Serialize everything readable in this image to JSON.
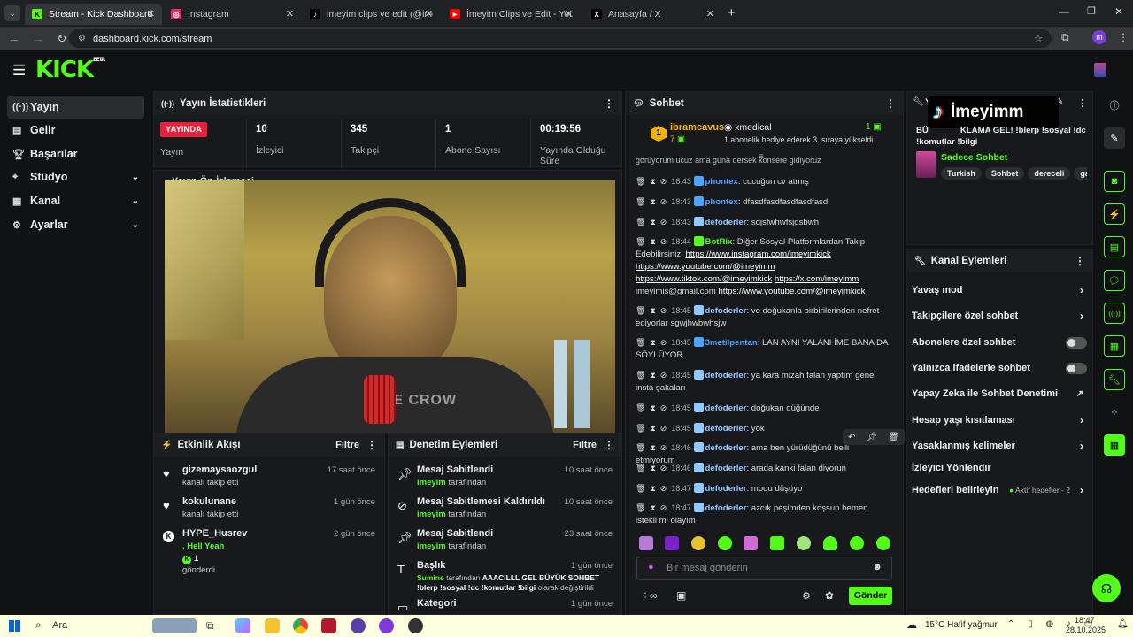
{
  "browser": {
    "tabs": [
      {
        "label": "Stream - Kick Dashboard",
        "color": "#53fc18",
        "glyph": "K"
      },
      {
        "label": "Instagram",
        "color": "#e1306c",
        "glyph": "◎"
      },
      {
        "label": "imeyim clips ve edit (@imeyimk",
        "color": "#111",
        "glyph": "♪"
      },
      {
        "label": "İmeyim Clips ve Edit - YouTube",
        "color": "#ff0000",
        "glyph": "▶"
      },
      {
        "label": "Anasayfa / X",
        "color": "#111",
        "glyph": "X"
      }
    ],
    "url": "dashboard.kick.com/stream",
    "profile_initial": "m"
  },
  "sidebar": {
    "items": [
      {
        "label": "Yayın",
        "icon": "broadcast-icon"
      },
      {
        "label": "Gelir",
        "icon": "revenue-icon"
      },
      {
        "label": "Başarılar",
        "icon": "trophy-icon"
      },
      {
        "label": "Stüdyo",
        "icon": "studio-icon"
      },
      {
        "label": "Kanal",
        "icon": "channel-icon"
      },
      {
        "label": "Ayarlar",
        "icon": "gear-icon"
      }
    ]
  },
  "stats": {
    "title": "Yayın İstatistikleri",
    "live_badge": "YAYINDA",
    "live_label": "Yayın",
    "items": [
      {
        "value": "10",
        "label": "İzleyici"
      },
      {
        "value": "345",
        "label": "Takipçi"
      },
      {
        "value": "1",
        "label": "Abone Sayısı"
      },
      {
        "value": "00:19:56",
        "label": "Yayında Olduğu Süre"
      }
    ]
  },
  "preview": {
    "title": "Yayın Ön İzlemesi",
    "shirt_text": "THE CROW"
  },
  "activity": {
    "title": "Etkinlik Akışı",
    "filter": "Filtre",
    "events": [
      {
        "name": "gizemaysaozgul",
        "sub": "kanalı takip etti",
        "time": "17 saat önce",
        "icon": "heart-icon"
      },
      {
        "name": "kokulunane",
        "sub": "kanalı takip etti",
        "time": "1 gün önce",
        "icon": "heart-icon"
      },
      {
        "name": "HYPE_Husrev",
        "line2": ", Hell Yeah",
        "line3": "1",
        "sub": "gönderdi",
        "time": "2 gün önce",
        "icon": "kick-coin-icon"
      }
    ]
  },
  "moderation": {
    "title": "Denetim Eylemleri",
    "filter": "Filtre",
    "items": [
      {
        "title": "Mesaj Sabitlendi",
        "by": "imeyim",
        "suffix": "tarafından",
        "time": "10 saat önce"
      },
      {
        "title": "Mesaj Sabitlemesi Kaldırıldı",
        "by": "imeyim",
        "suffix": "tarafından",
        "time": "10 saat önce"
      },
      {
        "title": "Mesaj Sabitlendi",
        "by": "imeyim",
        "suffix": "tarafından",
        "time": "23 saat önce"
      },
      {
        "title": "Başlık",
        "by": "Sumine",
        "suffix": "tarafından",
        "detail": "AAACILLL GEL BÜYÜK SOHBET !blerp !sosyal !dc !komutlar !bilgi",
        "detail_suffix": "olarak değiştirildi",
        "time": "1 gün önce"
      },
      {
        "title": "Kategori",
        "time": "1 gün önce"
      }
    ]
  },
  "chat": {
    "title": "Sohbet",
    "top_gifter": {
      "rank": "1",
      "name": "ibramcavus",
      "count": "7"
    },
    "gift_user": "xmedical",
    "gift_count": "1",
    "gift_text": "1 abonelik hediye ederek 3. sıraya yükseldi",
    "truncated_top": "görüyorum ucuz ama güna dersek konsere gidiyoruz",
    "messages": [
      {
        "time": "18:43",
        "user": "phontex",
        "color": "#4aa3ff",
        "text": "cocuğun cv atmış"
      },
      {
        "time": "18:43",
        "user": "phontex",
        "color": "#4aa3ff",
        "text": "dfasdfasdfasdfasdfasd"
      },
      {
        "time": "18:43",
        "user": "defoderler",
        "color": "#8fc7ff",
        "text": "sgjsfwhwfsjgsbwh"
      },
      {
        "time": "18:44",
        "user": "BotRix",
        "color": "#53fc18",
        "text": "Diğer Sosyal Platformlardan Takip Edebilirsiniz: ",
        "links": [
          "https://www.instagram.com/imeyimkick",
          "https://www.youtube.com/@imeyimm",
          "https://www.tiktok.com/@imeyimkick",
          "https://x.com/imeyimm"
        ],
        "tail": "imeyimis@gmail.com",
        "link_last": "https://www.youtube.com/@imeyimkick"
      },
      {
        "time": "18:45",
        "user": "defoderler",
        "color": "#8fc7ff",
        "text": "ve doğukanla birbirilerinden nefret ediyorlar sgwjhwbwhsjw"
      },
      {
        "time": "18:45",
        "user": "3metilpentan",
        "color": "#4aa3ff",
        "text": "LAN AYNI YALANI İME BANA DA SÖYLÜYOR"
      },
      {
        "time": "18:45",
        "user": "defoderler",
        "color": "#8fc7ff",
        "text": "ya kara mizah falan yaptım genel insta şakaları"
      },
      {
        "time": "18:45",
        "user": "defoderler",
        "color": "#8fc7ff",
        "text": "doğukan düğünde"
      },
      {
        "time": "18:45",
        "user": "defoderler",
        "color": "#8fc7ff",
        "text": "yok"
      },
      {
        "time": "18:46",
        "user": "defoderler",
        "color": "#8fc7ff",
        "text": "ama ben yürüdüğünü belli etmiyorum"
      },
      {
        "time": "18:46",
        "user": "defoderler",
        "color": "#8fc7ff",
        "text": "arada kanki falan diyorun"
      },
      {
        "time": "18:47",
        "user": "defoderler",
        "color": "#8fc7ff",
        "text": "modu düşüyo"
      },
      {
        "time": "18:47",
        "user": "defoderler",
        "color": "#8fc7ff",
        "text": "azcık peşimden koşsun hemen istekli mi olayım"
      }
    ],
    "input_placeholder": "Bir mesaj gönderin",
    "send_label": "Gönder"
  },
  "stream_info": {
    "title_partial": "BÜYÜK SOHBET GEL! !blerp !sosyal !dc !komutlar !bilgi",
    "title_prefix": "Y",
    "title_visible": "BÜ",
    "title_rest": "KLAMA GEL! !blerp !sosyal !dc",
    "title_line2": "!komutlar !bilgi",
    "category": "Sadece Sohbet",
    "tags": [
      "Turkish",
      "Sohbet",
      "dereceli",
      "gamin"
    ],
    "watermark": "İmeyimm"
  },
  "channel_actions": {
    "title": "Kanal Eylemleri",
    "items": [
      {
        "label": "Yavaş mod",
        "type": "chevron"
      },
      {
        "label": "Takipçilere özel sohbet",
        "type": "chevron"
      },
      {
        "label": "Abonelere özel sohbet",
        "type": "toggle"
      },
      {
        "label": "Yalnızca ifadelerle sohbet",
        "type": "toggle"
      },
      {
        "label": "Yapay Zeka ile Sohbet Denetimi",
        "type": "external"
      },
      {
        "label": "Hesap yaşı kısıtlaması",
        "type": "chevron"
      },
      {
        "label": "Yasaklanmış kelimeler",
        "type": "chevron"
      },
      {
        "label": "İzleyici Yönlendir",
        "type": "none"
      },
      {
        "label": "Hedefleri belirleyin",
        "type": "chevron",
        "badge": "Aktif hedefler - 2"
      }
    ]
  },
  "taskbar": {
    "search": "Ara",
    "weather": "15°C  Hafif yağmur",
    "time": "18:47",
    "date": "28.10.2025"
  },
  "colors": {
    "accent": "#53fc18",
    "live": "#e8203c",
    "panel": "#18191c",
    "bg": "#111214"
  }
}
